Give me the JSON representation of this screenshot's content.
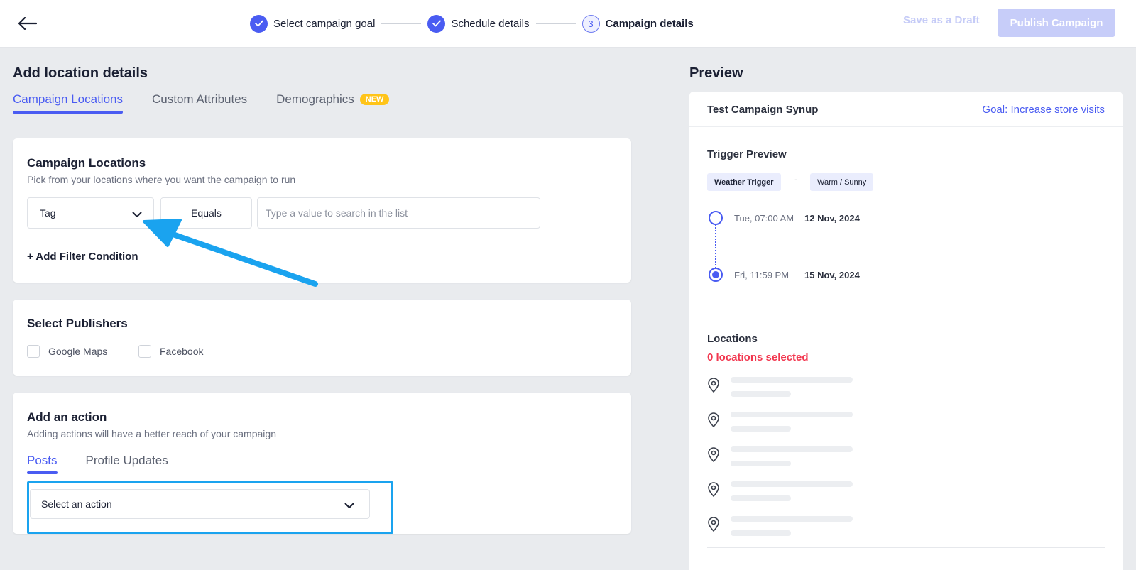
{
  "topbar": {
    "steps": [
      {
        "label": "Select campaign goal",
        "state": "done"
      },
      {
        "label": "Schedule details",
        "state": "done"
      },
      {
        "label": "Campaign details",
        "number": "3",
        "state": "current"
      }
    ],
    "save_draft_label": "Save as a Draft",
    "publish_label": "Publish Campaign"
  },
  "left": {
    "title": "Add location details",
    "tabs": [
      {
        "label": "Campaign Locations",
        "active": true
      },
      {
        "label": "Custom Attributes",
        "active": false
      },
      {
        "label": "Demographics",
        "badge": "NEW",
        "active": false
      }
    ],
    "campaign_locations": {
      "title": "Campaign Locations",
      "subtitle": "Pick from your locations where you want the campaign to run",
      "filter_field": "Tag",
      "operator": "Equals",
      "value_placeholder": "Type a value to search in the list",
      "add_filter_label": "+ Add Filter Condition"
    },
    "publishers": {
      "title": "Select Publishers",
      "options": [
        {
          "label": "Google Maps",
          "checked": false
        },
        {
          "label": "Facebook",
          "checked": false
        }
      ]
    },
    "action": {
      "title": "Add an action",
      "subtitle": "Adding actions will have a better reach of your campaign",
      "tabs": [
        {
          "label": "Posts",
          "active": true
        },
        {
          "label": "Profile Updates",
          "active": false
        }
      ],
      "select_label": "Select an action"
    }
  },
  "preview": {
    "title": "Preview",
    "campaign_name": "Test Campaign Synup",
    "goal": "Goal: Increase store visits",
    "trigger_label": "Trigger Preview",
    "trigger_chip": "Weather Trigger",
    "trigger_separator": "-",
    "trigger_value": "Warm / Sunny",
    "timeline": [
      {
        "time": "Tue, 07:00 AM",
        "date": "12 Nov, 2024"
      },
      {
        "time": "Fri, 11:59 PM",
        "date": "15 Nov, 2024"
      }
    ],
    "locations_label": "Locations",
    "locations_count": "0 locations selected"
  },
  "colors": {
    "accent": "#4a5cf2",
    "annotation": "#1aa3ef",
    "warning": "#f2374f",
    "badge": "#ffc419"
  }
}
